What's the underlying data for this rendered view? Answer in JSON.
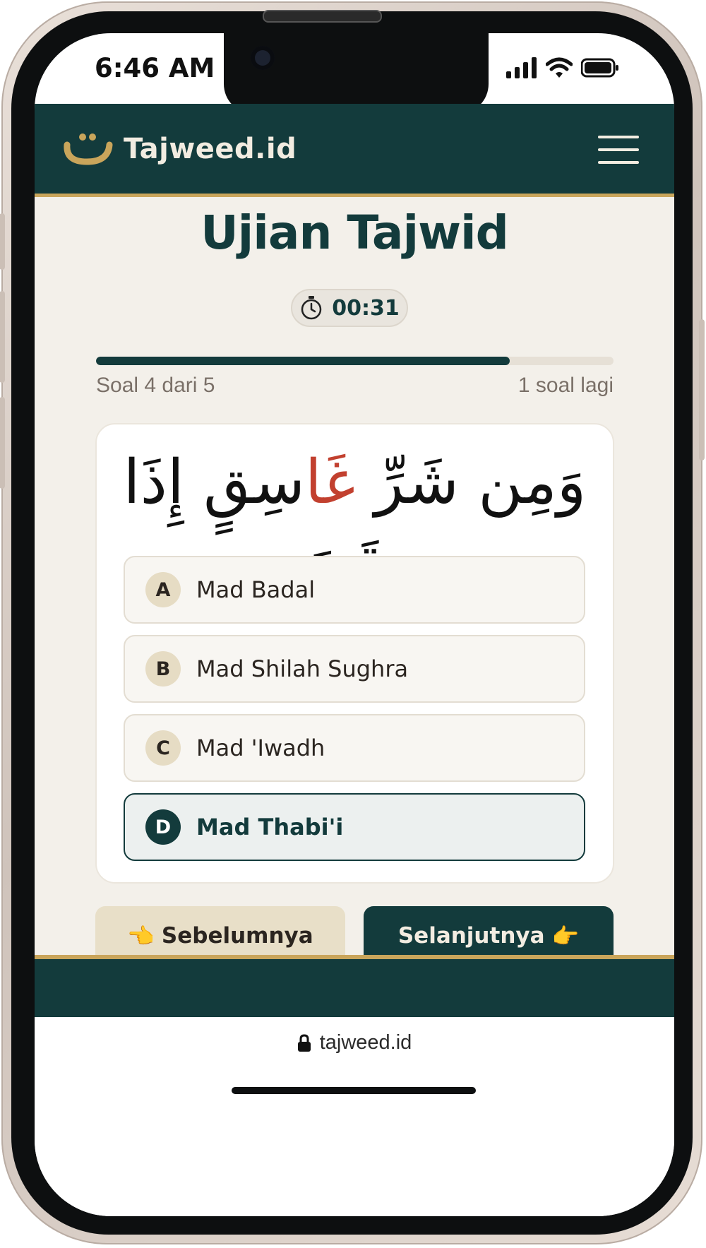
{
  "status_bar": {
    "time": "6:46 AM"
  },
  "header": {
    "brand": "Tajweed.id",
    "logo_glyph": "ت"
  },
  "quiz": {
    "title": "Ujian Tajwid",
    "timer": "00:31",
    "progress_fraction": 0.8,
    "progress_left": "Soal 4 dari 5",
    "progress_right": "1 soal lagi",
    "ayah": {
      "before": "وَمِن شَرِّ ",
      "highlight": "غَا",
      "after": "سِقٍ إِذَا وَقَبَ"
    },
    "options": [
      {
        "letter": "A",
        "label": "Mad Badal",
        "selected": false
      },
      {
        "letter": "B",
        "label": "Mad Shilah Sughra",
        "selected": false
      },
      {
        "letter": "C",
        "label": "Mad 'Iwadh",
        "selected": false
      },
      {
        "letter": "D",
        "label": "Mad Thabi'i",
        "selected": true
      }
    ]
  },
  "nav": {
    "prev_label": "Sebelumnya",
    "prev_icon": "👈",
    "next_label": "Selanjutnya",
    "next_icon": "👉"
  },
  "browser": {
    "url": "tajweed.id"
  },
  "colors": {
    "primary": "#133b3c",
    "gold": "#c9a55b",
    "background": "#f3f0ea",
    "highlight": "#c2402f",
    "secondary_button": "#e8dfc8"
  }
}
